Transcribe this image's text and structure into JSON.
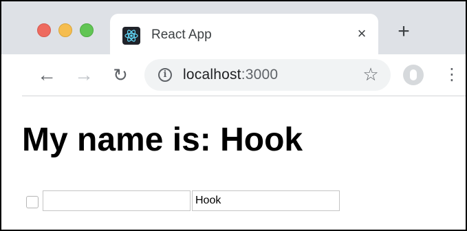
{
  "browser": {
    "tab": {
      "title": "React App",
      "close_glyph": "×",
      "favicon": "react-logo-icon"
    },
    "new_tab_glyph": "+",
    "toolbar": {
      "back_glyph": "←",
      "forward_glyph": "→",
      "reload_glyph": "↻",
      "url_host": "localhost",
      "url_port": ":3000",
      "bookmark_glyph": "☆",
      "menu_glyph": "⋮",
      "info_glyph": "i"
    },
    "traffic_colors": {
      "close": "#ee6a5f",
      "minimize": "#f5bd4f",
      "maximize": "#61c554"
    }
  },
  "page": {
    "heading": "My name is: Hook",
    "checkbox_checked": false,
    "input_first_value": "",
    "input_second_value": "Hook"
  }
}
